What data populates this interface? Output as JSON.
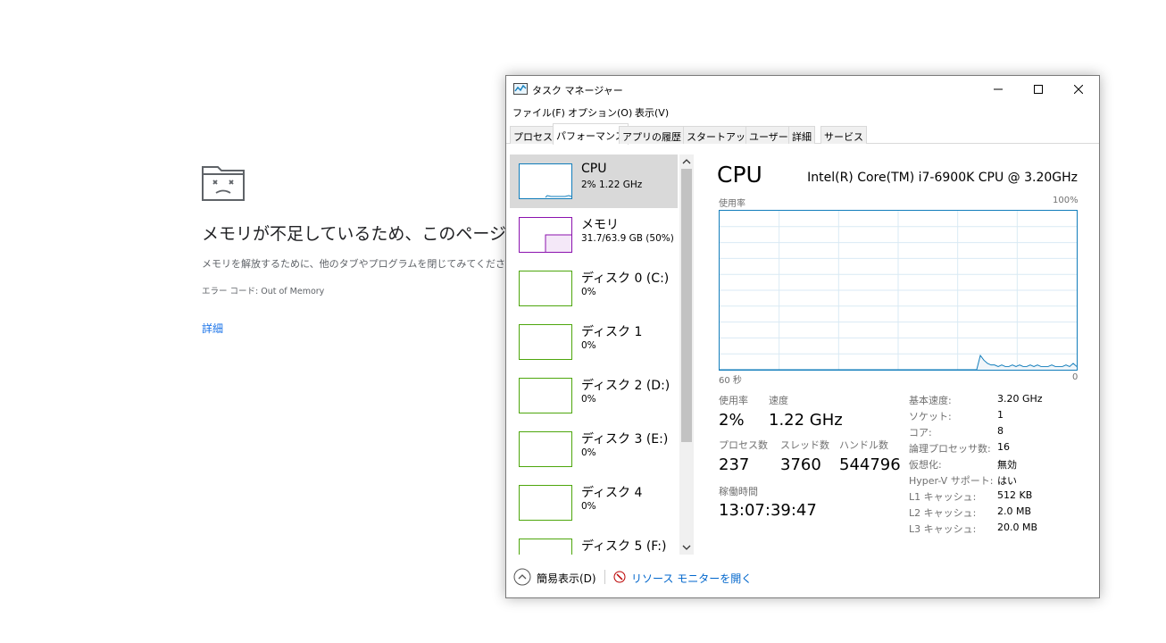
{
  "error_page": {
    "title": "メモリが不足しているため、このページを開けませ",
    "message": "メモリを解放するために、他のタブやプログラムを閉じてみてください。",
    "error_code": "エラー コード: Out of Memory",
    "details_link": "詳細"
  },
  "taskmgr": {
    "title": "タスク マネージャー",
    "menu": [
      "ファイル(F)",
      "オプション(O)",
      "表示(V)"
    ],
    "tabs": [
      "プロセス",
      "パフォーマンス",
      "アプリの履歴",
      "スタートアップ",
      "ユーザー",
      "詳細",
      "サービス"
    ],
    "active_tab": 1,
    "resources": [
      {
        "name": "CPU",
        "value": "2%  1.22 GHz",
        "color": "#117dbb"
      },
      {
        "name": "メモリ",
        "value": "31.7/63.9 GB (50%)",
        "color": "#8b12ae"
      },
      {
        "name": "ディスク 0 (C:)",
        "value": "0%",
        "color": "#4da60c"
      },
      {
        "name": "ディスク 1",
        "value": "0%",
        "color": "#4da60c"
      },
      {
        "name": "ディスク 2 (D:)",
        "value": "0%",
        "color": "#4da60c"
      },
      {
        "name": "ディスク 3 (E:)",
        "value": "0%",
        "color": "#4da60c"
      },
      {
        "name": "ディスク 4",
        "value": "0%",
        "color": "#4da60c"
      },
      {
        "name": "ディスク 5 (F:)",
        "value": "",
        "color": "#4da60c"
      }
    ],
    "cpu": {
      "heading": "CPU",
      "model": "Intel(R) Core(TM) i7-6900K CPU @ 3.20GHz",
      "graph_label": "使用率",
      "graph_max": "100%",
      "graph_time": "60 秒",
      "graph_zero": "0",
      "usage_samples": [
        0,
        0,
        0,
        0,
        0,
        0,
        0,
        0,
        0,
        0,
        0,
        0,
        0,
        0,
        0,
        0,
        0,
        0,
        0,
        0,
        0,
        0,
        0,
        0,
        0,
        0,
        0,
        0,
        0,
        0,
        0,
        0,
        0,
        0,
        0,
        0,
        0,
        0,
        0,
        0,
        0,
        0,
        0,
        0,
        0,
        0,
        0,
        0,
        0,
        0,
        0,
        0,
        0,
        0,
        0,
        0,
        0,
        0,
        0,
        0,
        0,
        0,
        0,
        0,
        0,
        0,
        0,
        0,
        0,
        0,
        0,
        0,
        0,
        9,
        6,
        4,
        3,
        3,
        2,
        3,
        2,
        2,
        3,
        2,
        3,
        2,
        2,
        3,
        2,
        3,
        2,
        2,
        2,
        3,
        2,
        2,
        2,
        3,
        2,
        4,
        2
      ],
      "stats": [
        {
          "label": "使用率",
          "value": "2%"
        },
        {
          "label": "速度",
          "value": "1.22 GHz"
        },
        {
          "label": "プロセス数",
          "value": "237"
        },
        {
          "label": "スレッド数",
          "value": "3760"
        },
        {
          "label": "ハンドル数",
          "value": "544796"
        },
        {
          "label": "稼働時間",
          "value": "13:07:39:47"
        }
      ],
      "specs": [
        {
          "k": "基本速度:",
          "v": "3.20 GHz"
        },
        {
          "k": "ソケット:",
          "v": "1"
        },
        {
          "k": "コア:",
          "v": "8"
        },
        {
          "k": "論理プロセッサ数:",
          "v": "16"
        },
        {
          "k": "仮想化:",
          "v": "無効"
        },
        {
          "k": "Hyper-V サポート:",
          "v": "はい"
        },
        {
          "k": "L1 キャッシュ:",
          "v": "512 KB"
        },
        {
          "k": "L2 キャッシュ:",
          "v": "2.0 MB"
        },
        {
          "k": "L3 キャッシュ:",
          "v": "20.0 MB"
        }
      ]
    },
    "footer": {
      "fewer_details": "簡易表示(D)",
      "resource_monitor": "リソース モニターを開く"
    }
  }
}
